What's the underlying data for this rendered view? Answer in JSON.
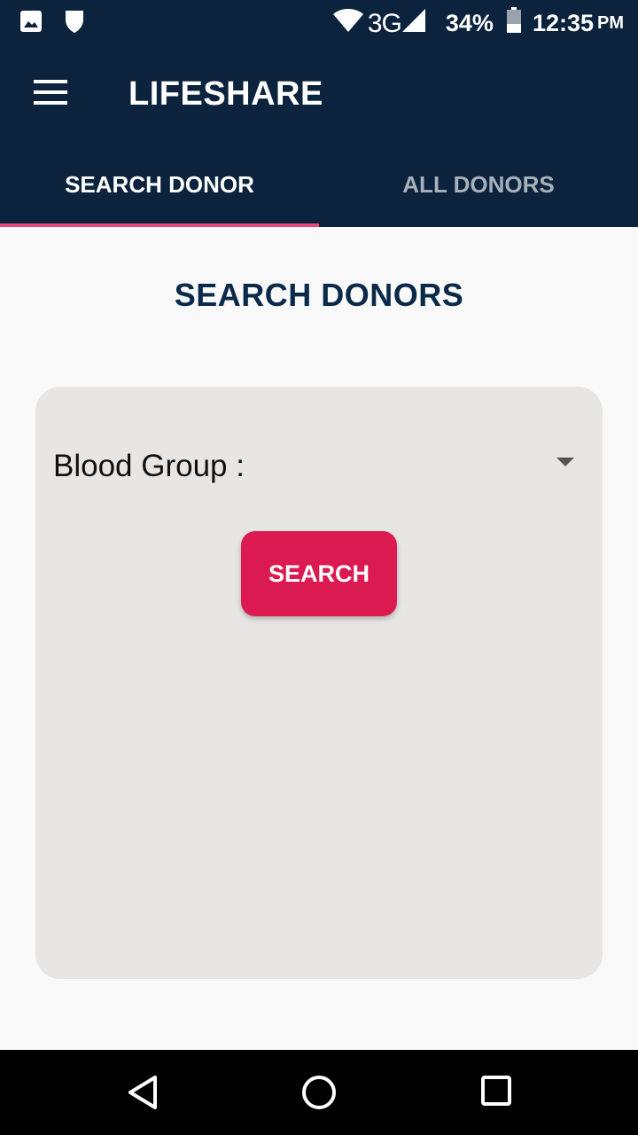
{
  "status_bar": {
    "network": "3G",
    "battery": "34%",
    "time": "12:35",
    "ampm": "PM",
    "icons": [
      "image-icon",
      "shield-icon",
      "wifi-icon",
      "signal-icon",
      "battery-icon"
    ]
  },
  "app_bar": {
    "title": "LIFESHARE",
    "menu_icon": "hamburger-menu-icon"
  },
  "tabs": [
    {
      "label": "SEARCH DONOR",
      "active": true
    },
    {
      "label": "ALL DONORS",
      "active": false
    }
  ],
  "main": {
    "heading": "SEARCH DONORS",
    "blood_group_label": "Blood Group :",
    "search_button": "SEARCH"
  },
  "nav_bar": {
    "icons": [
      "back-icon",
      "home-icon",
      "recents-icon"
    ]
  },
  "colors": {
    "primary_dark": "#0b233c",
    "accent_pink": "#e8467a",
    "button_red": "#dc1a52",
    "card_bg": "#e7e6e4",
    "heading_text": "#0b2a4a"
  }
}
